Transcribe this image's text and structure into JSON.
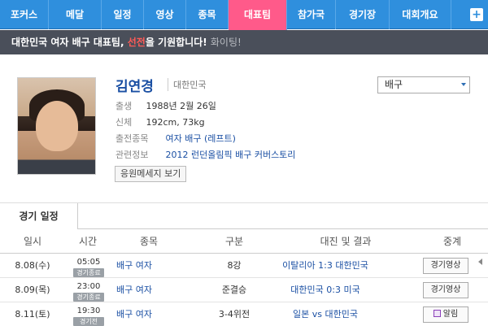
{
  "nav": {
    "tabs": [
      "포커스",
      "메달",
      "일정",
      "영상",
      "종목",
      "대표팀",
      "참가국",
      "경기장",
      "대회개요"
    ],
    "active_index": 5,
    "plus": "+"
  },
  "banner": {
    "text_pre": "대한민국 여자 배구 대표팀, ",
    "text_red": "선전",
    "text_post": "을 기원합니다! ",
    "cheer": "화이팅!"
  },
  "profile": {
    "name": "김연경",
    "country": "대한민국",
    "birth_label": "출생",
    "birth": "1988년 2월 26일",
    "body_label": "신체",
    "body": "192cm, 73kg",
    "event_label": "출전종목",
    "event": "여자 배구 (레프트)",
    "related_label": "관련정보",
    "related": "2012 런던올림픽 배구 커버스토리",
    "cheer_button": "응원메세지 보기",
    "select_value": "배구"
  },
  "schedule": {
    "tab": "경기 일정",
    "headers": [
      "일시",
      "시간",
      "종목",
      "구분",
      "대진 및 결과",
      "중계"
    ],
    "rows": [
      {
        "date": "8.08(수)",
        "time": "05:05",
        "status": "경기종료",
        "sport": "배구 여자",
        "round": "8강",
        "match": "이탈리아 1:3 대한민국",
        "button": "경기영상",
        "alarm": false
      },
      {
        "date": "8.09(목)",
        "time": "23:00",
        "status": "경기종료",
        "sport": "배구 여자",
        "round": "준결승",
        "match": "대한민국 0:3 미국",
        "button": "경기영상",
        "alarm": false
      },
      {
        "date": "8.11(토)",
        "time": "19:30",
        "status": "경기전",
        "sport": "배구 여자",
        "round": "3-4위전",
        "match": "일본 vs 대한민국",
        "button": "알림",
        "alarm": true
      }
    ]
  }
}
